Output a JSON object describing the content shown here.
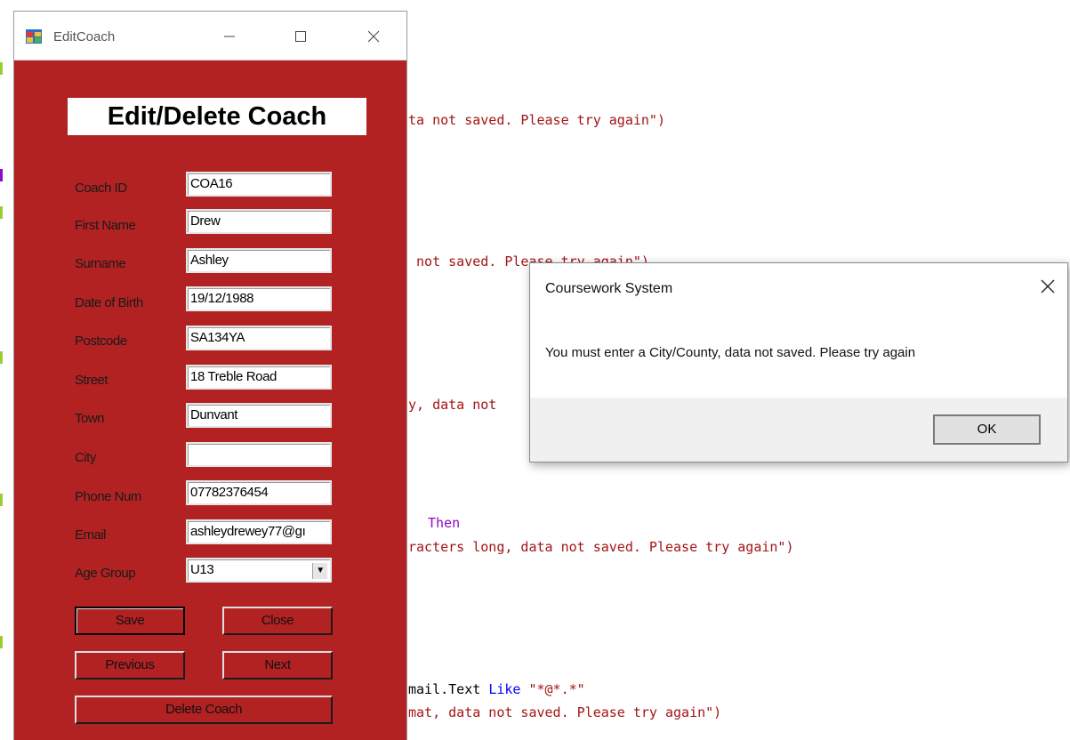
{
  "code": {
    "line_top": "",
    "line1": "ta not saved. Please try again\")",
    "line2": " not saved. Please try again\")",
    "line3": "y, data not",
    "line4_kw": "Then",
    "line5": "racters long, data not saved. Please try again\")",
    "line6_plain": "mail.Text ",
    "line6_kw": "Like",
    "line6_str": " \"*@*.*\"",
    "line7": "mat, data not saved. Please try again\")"
  },
  "window": {
    "title": "EditCoach",
    "heading": "Edit/Delete Coach",
    "fields": [
      {
        "label": "Coach ID",
        "value": "COA16"
      },
      {
        "label": "First Name",
        "value": "Drew"
      },
      {
        "label": "Surname",
        "value": "Ashley"
      },
      {
        "label": "Date of Birth",
        "value": "19/12/1988"
      },
      {
        "label": "Postcode",
        "value": "SA134YA"
      },
      {
        "label": "Street",
        "value": "18 Treble Road"
      },
      {
        "label": "Town",
        "value": "Dunvant"
      },
      {
        "label": "City",
        "value": ""
      },
      {
        "label": "Phone Num",
        "value": "07782376454"
      },
      {
        "label": "Email",
        "value": "ashleydrewey77@gı"
      },
      {
        "label": "Age Group",
        "value": "U13"
      }
    ],
    "buttons": {
      "save": "Save",
      "close": "Close",
      "previous": "Previous",
      "next": "Next",
      "delete": "Delete Coach"
    }
  },
  "dialog": {
    "title": "Coursework System",
    "message": "You must enter a City/County, data not saved. Please try again",
    "ok": "OK"
  },
  "icons": {
    "app": "app-window-icon",
    "minimize": "minimize-icon",
    "maximize": "maximize-icon",
    "close": "close-icon",
    "dropdown": "chevron-down-icon"
  }
}
